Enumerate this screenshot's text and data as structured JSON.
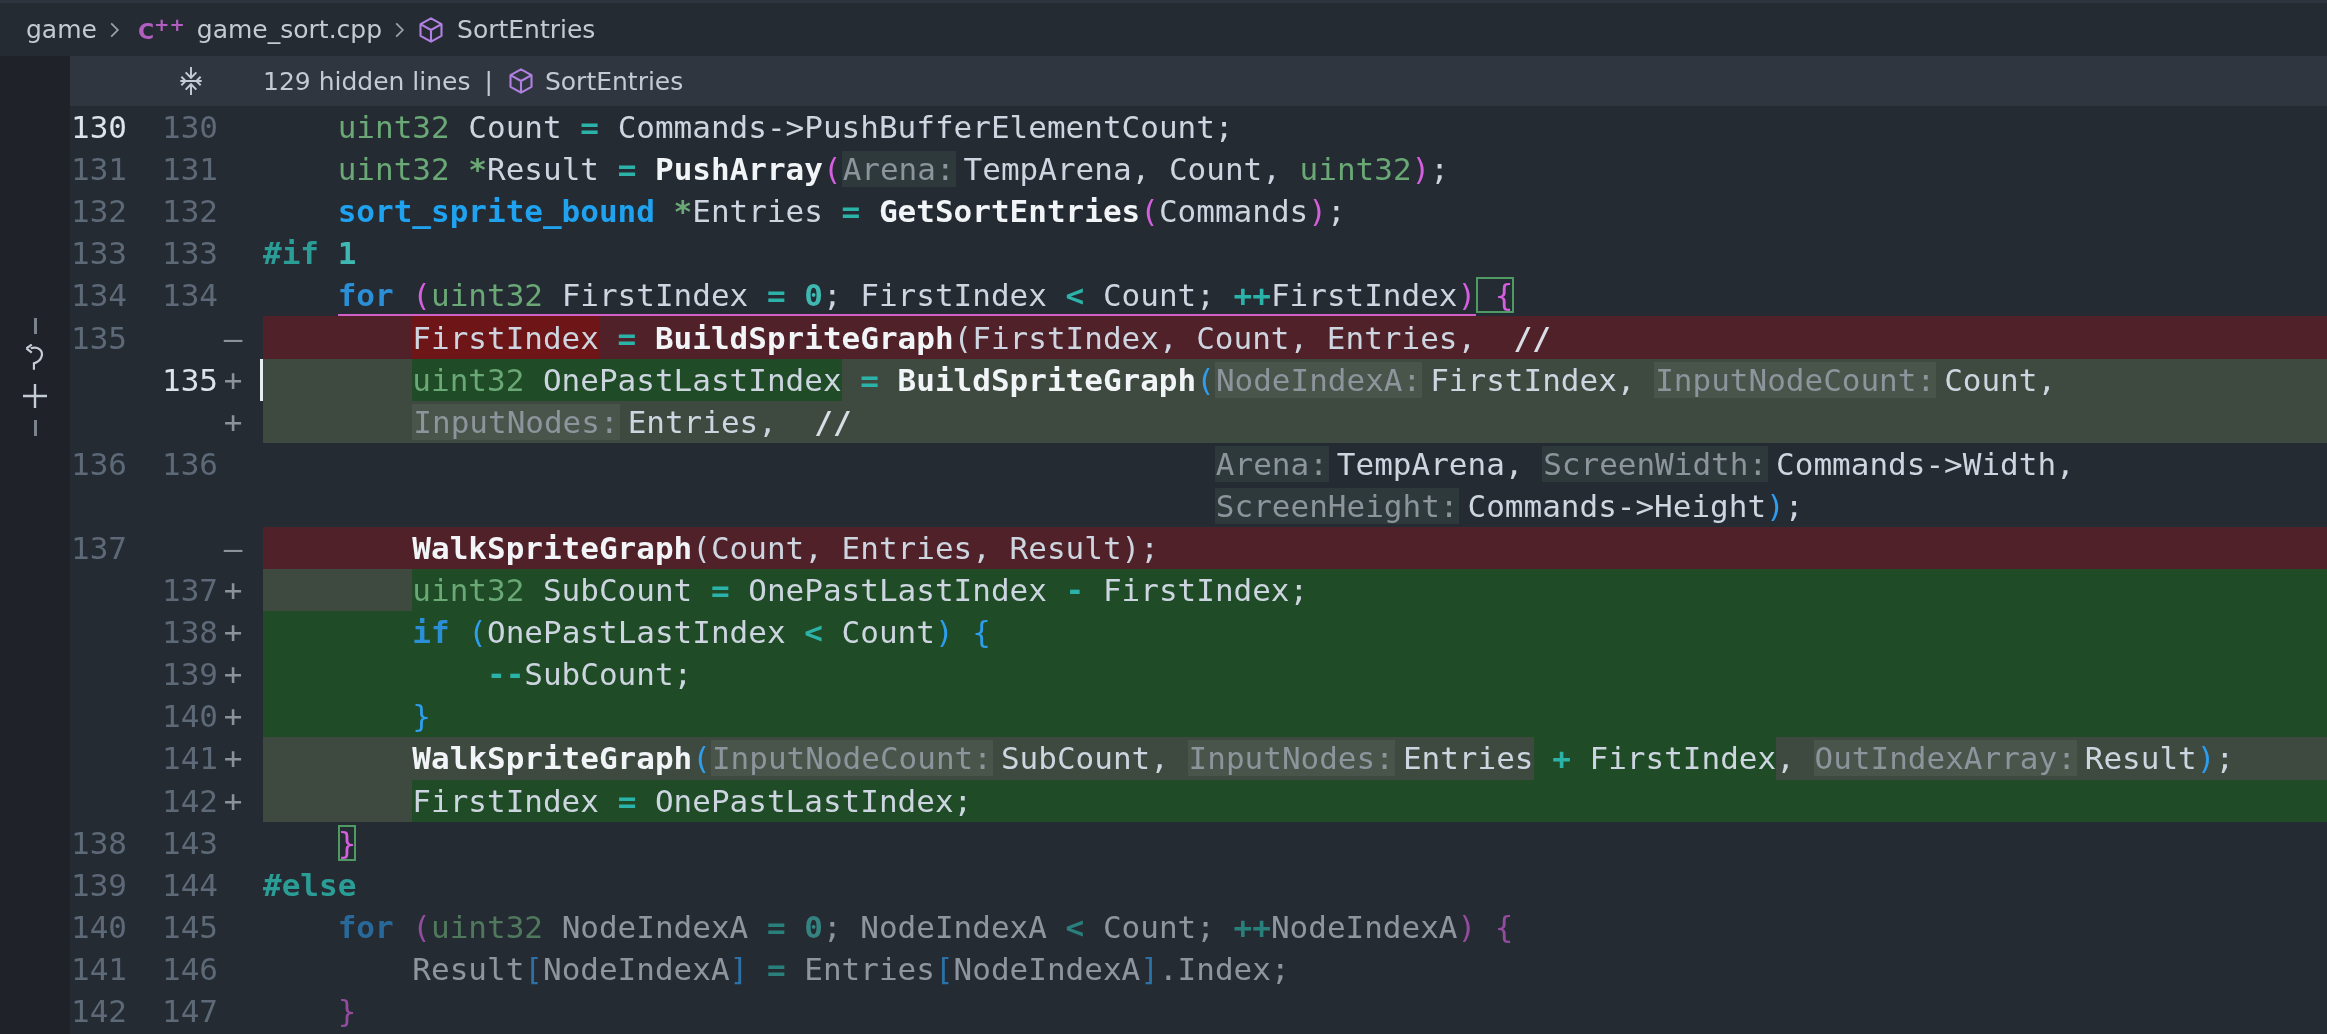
{
  "breadcrumb": [
    {
      "kind": "folder",
      "text": "game"
    },
    {
      "kind": "file",
      "icon": "C$^{++}$",
      "text": "game_sort.cpp"
    },
    {
      "kind": "symbol",
      "text": "SortEntries"
    }
  ],
  "fold_bar": {
    "text": "129 hidden lines",
    "separator": "|",
    "symbol": "SortEntries"
  },
  "lines": [
    {
      "orig": "130",
      "mod": "130",
      "kind": "context",
      "orig_current": true,
      "mod_current": false,
      "inactive": false,
      "segments": [
        {
          "kind": "plain",
          "tokens": [
            {
              "kind": "type",
              "text": "    uint32"
            },
            {
              "kind": "plain",
              "text": " Count "
            },
            {
              "kind": "op",
              "text": "="
            },
            {
              "kind": "plain",
              "text": " Commands->PushBufferElementCount;"
            }
          ]
        }
      ]
    },
    {
      "orig": "131",
      "mod": "131",
      "kind": "context",
      "orig_current": false,
      "mod_current": false,
      "inactive": false,
      "segments": [
        {
          "kind": "plain",
          "tokens": [
            {
              "kind": "type",
              "text": "    uint32 "
            },
            {
              "kind": "star",
              "text": "*"
            },
            {
              "kind": "plain",
              "text": "Result "
            },
            {
              "kind": "op",
              "text": "="
            },
            {
              "kind": "func",
              "text": " PushArray"
            },
            {
              "kind": "paren",
              "text": "("
            },
            {
              "kind": "hint",
              "text": "Arena:"
            },
            {
              "kind": "plain",
              "text": "TempArena, Count, "
            },
            {
              "kind": "type",
              "text": "uint32"
            },
            {
              "kind": "paren",
              "text": ")"
            },
            {
              "kind": "plain",
              "text": ";"
            }
          ]
        }
      ]
    },
    {
      "orig": "132",
      "mod": "132",
      "kind": "context",
      "orig_current": false,
      "mod_current": false,
      "inactive": false,
      "segments": [
        {
          "kind": "plain",
          "tokens": [
            {
              "kind": "struct",
              "text": "    sort_sprite_bound "
            },
            {
              "kind": "star",
              "text": "*"
            },
            {
              "kind": "plain",
              "text": "Entries "
            },
            {
              "kind": "op",
              "text": "="
            },
            {
              "kind": "func",
              "text": " GetSortEntries"
            },
            {
              "kind": "paren",
              "text": "("
            },
            {
              "kind": "plain",
              "text": "Commands"
            },
            {
              "kind": "paren",
              "text": ")"
            },
            {
              "kind": "plain",
              "text": ";"
            }
          ]
        }
      ]
    },
    {
      "orig": "133",
      "mod": "133",
      "kind": "context",
      "orig_current": false,
      "mod_current": false,
      "inactive": false,
      "segments": [
        {
          "kind": "plain",
          "tokens": [
            {
              "kind": "macro",
              "text": "#if "
            },
            {
              "kind": "number",
              "text": "1"
            }
          ]
        }
      ]
    },
    {
      "orig": "134",
      "mod": "134",
      "kind": "context",
      "orig_current": false,
      "mod_current": false,
      "inactive": false,
      "segments": [
        {
          "kind": "underlined",
          "tokens": [
            {
              "kind": "keyword",
              "text": "    for "
            },
            {
              "kind": "paren",
              "text": "("
            },
            {
              "kind": "type",
              "text": "uint32"
            },
            {
              "kind": "plain",
              "text": " FirstIndex "
            },
            {
              "kind": "op",
              "text": "="
            },
            {
              "kind": "number",
              "text": " 0"
            },
            {
              "kind": "plain",
              "text": "; FirstIndex "
            },
            {
              "kind": "op",
              "text": "<"
            },
            {
              "kind": "plain",
              "text": " Count; "
            },
            {
              "kind": "op",
              "text": "++"
            },
            {
              "kind": "plain",
              "text": "FirstIndex"
            },
            {
              "kind": "paren",
              "text": ")"
            }
          ]
        },
        {
          "kind": "plain",
          "tokens": [
            {
              "kind": "match",
              "text": " {"
            }
          ]
        }
      ]
    },
    {
      "orig": "135",
      "marker": "—",
      "kind": "removed",
      "orig_current": false,
      "inactive": false,
      "segments": [
        {
          "kind": "changed",
          "tokens": [
            {
              "kind": "plain",
              "text": "        FirstIndex"
            }
          ]
        },
        {
          "kind": "plain",
          "tokens": [
            {
              "kind": "op",
              "text": " = "
            },
            {
              "kind": "func",
              "text": "BuildSpriteGraph"
            },
            {
              "kind": "plain",
              "text": "(FirstIndex, Count, Entries,  "
            },
            {
              "kind": "comment",
              "text": "//"
            }
          ]
        }
      ]
    },
    {
      "mod": "135",
      "marker": "+",
      "kind": "added",
      "mod_current": true,
      "inactive": false,
      "segments": [
        {
          "kind": "changed",
          "tokens": [
            {
              "kind": "type",
              "text": "        uint32"
            },
            {
              "kind": "plain",
              "text": " OnePastLastIndex"
            }
          ]
        },
        {
          "kind": "plain",
          "tokens": [
            {
              "kind": "op",
              "text": " = "
            },
            {
              "kind": "func",
              "text": "BuildSpriteGraph"
            },
            {
              "kind": "paren2",
              "text": "("
            },
            {
              "kind": "hint",
              "text": "NodeIndexA:"
            },
            {
              "kind": "plain",
              "text": "FirstIndex, "
            },
            {
              "kind": "hint",
              "text": "InputNodeCount:"
            },
            {
              "kind": "plain",
              "text": "Count,"
            }
          ]
        }
      ]
    },
    {
      "marker": "+",
      "kind": "added",
      "inactive": false,
      "segments": [
        {
          "kind": "plain",
          "tokens": [
            {
              "kind": "hint",
              "text": "        InputNodes:"
            },
            {
              "kind": "plain",
              "text": "Entries,  "
            },
            {
              "kind": "comment",
              "text": "//"
            }
          ]
        }
      ]
    },
    {
      "orig": "136",
      "mod": "136",
      "kind": "context",
      "orig_current": false,
      "mod_current": false,
      "inactive": false,
      "segments": [
        {
          "kind": "plain",
          "tokens": [
            {
              "kind": "hint",
              "text": "                                                   Arena:"
            },
            {
              "kind": "plain",
              "text": "TempArena, "
            },
            {
              "kind": "hint",
              "text": "ScreenWidth:"
            },
            {
              "kind": "plain",
              "text": "Commands->Width,"
            }
          ]
        }
      ]
    },
    {
      "kind": "context",
      "inactive": false,
      "segments": [
        {
          "kind": "plain",
          "tokens": [
            {
              "kind": "hint",
              "text": "                                                   ScreenHeight:"
            },
            {
              "kind": "plain",
              "text": "Commands->Height"
            },
            {
              "kind": "paren2",
              "text": ")"
            },
            {
              "kind": "plain",
              "text": ";"
            }
          ]
        }
      ]
    },
    {
      "orig": "137",
      "marker": "—",
      "kind": "removed",
      "orig_current": false,
      "inactive": false,
      "segments": [
        {
          "kind": "plain",
          "tokens": [
            {
              "kind": "func",
              "text": "        WalkSpriteGraph"
            },
            {
              "kind": "plain",
              "text": "(Count, Entries, Result);"
            }
          ]
        }
      ]
    },
    {
      "mod": "137",
      "marker": "+",
      "kind": "added",
      "mod_current": false,
      "inactive": false,
      "segments": [
        {
          "kind": "changed",
          "tokens": [
            {
              "kind": "type",
              "text": "        uint32"
            },
            {
              "kind": "plain",
              "text": " SubCount "
            },
            {
              "kind": "op",
              "text": "="
            },
            {
              "kind": "plain",
              "text": " OnePastLastIndex "
            },
            {
              "kind": "op",
              "text": "-"
            },
            {
              "kind": "plain",
              "text": " FirstIndex;"
            }
          ]
        }
      ]
    },
    {
      "mod": "138",
      "marker": "+",
      "kind": "added",
      "mod_current": false,
      "inactive": false,
      "segments": [
        {
          "kind": "changed-all",
          "tokens": [
            {
              "kind": "keyword",
              "text": "        if "
            },
            {
              "kind": "paren2",
              "text": "("
            },
            {
              "kind": "plain",
              "text": "OnePastLastIndex "
            },
            {
              "kind": "op",
              "text": "<"
            },
            {
              "kind": "plain",
              "text": " Count"
            },
            {
              "kind": "paren2",
              "text": ")"
            },
            {
              "kind": "paren2",
              "text": " {"
            }
          ]
        }
      ]
    },
    {
      "mod": "139",
      "marker": "+",
      "kind": "added",
      "mod_current": false,
      "inactive": false,
      "segments": [
        {
          "kind": "changed-all",
          "tokens": [
            {
              "kind": "op",
              "text": "            --"
            },
            {
              "kind": "plain",
              "text": "SubCount;"
            }
          ]
        }
      ]
    },
    {
      "mod": "140",
      "marker": "+",
      "kind": "added",
      "mod_current": false,
      "inactive": false,
      "segments": [
        {
          "kind": "changed-all",
          "tokens": [
            {
              "kind": "paren2",
              "text": "        }"
            }
          ]
        }
      ]
    },
    {
      "mod": "141",
      "marker": "+",
      "kind": "added",
      "mod_current": false,
      "inactive": false,
      "segments": [
        {
          "kind": "plain",
          "tokens": [
            {
              "kind": "func",
              "text": "        WalkSpriteGraph"
            },
            {
              "kind": "paren2",
              "text": "("
            },
            {
              "kind": "hint",
              "text": "InputNodeCount:"
            },
            {
              "kind": "plain",
              "text": "SubCount, "
            },
            {
              "kind": "hint",
              "text": "InputNodes:"
            },
            {
              "kind": "plain",
              "text": "Entries"
            }
          ]
        },
        {
          "kind": "changed",
          "tokens": [
            {
              "kind": "op",
              "text": " + "
            },
            {
              "kind": "plain",
              "text": "FirstIndex"
            }
          ]
        },
        {
          "kind": "plain",
          "tokens": [
            {
              "kind": "plain",
              "text": ", "
            },
            {
              "kind": "hint",
              "text": "OutIndexArray:"
            },
            {
              "kind": "plain",
              "text": "Result"
            },
            {
              "kind": "paren2",
              "text": ")"
            },
            {
              "kind": "plain",
              "text": ";"
            }
          ]
        }
      ]
    },
    {
      "mod": "142",
      "marker": "+",
      "kind": "added",
      "mod_current": false,
      "inactive": false,
      "segments": [
        {
          "kind": "changed",
          "tokens": [
            {
              "kind": "plain",
              "text": "        FirstIndex "
            },
            {
              "kind": "op",
              "text": "="
            },
            {
              "kind": "plain",
              "text": " OnePastLastIndex;"
            }
          ]
        }
      ]
    },
    {
      "orig": "138",
      "mod": "143",
      "kind": "context",
      "orig_current": false,
      "mod_current": false,
      "inactive": false,
      "segments": [
        {
          "kind": "plain",
          "tokens": [
            {
              "kind": "match",
              "text": "    }"
            }
          ]
        }
      ]
    },
    {
      "orig": "139",
      "mod": "144",
      "kind": "context",
      "orig_current": false,
      "mod_current": false,
      "inactive": false,
      "segments": [
        {
          "kind": "plain",
          "tokens": [
            {
              "kind": "macro",
              "text": "#else"
            }
          ]
        }
      ]
    },
    {
      "orig": "140",
      "mod": "145",
      "kind": "context",
      "orig_current": false,
      "mod_current": false,
      "inactive": true,
      "segments": [
        {
          "kind": "plain",
          "tokens": [
            {
              "kind": "keyword",
              "text": "    for "
            },
            {
              "kind": "paren",
              "text": "("
            },
            {
              "kind": "type",
              "text": "uint32"
            },
            {
              "kind": "plain",
              "text": " NodeIndexA "
            },
            {
              "kind": "op",
              "text": "="
            },
            {
              "kind": "number",
              "text": " 0"
            },
            {
              "kind": "plain",
              "text": "; NodeIndexA "
            },
            {
              "kind": "op",
              "text": "<"
            },
            {
              "kind": "plain",
              "text": " Count; "
            },
            {
              "kind": "op",
              "text": "++"
            },
            {
              "kind": "plain",
              "text": "NodeIndexA"
            },
            {
              "kind": "paren",
              "text": ")"
            },
            {
              "kind": "paren",
              "text": " {"
            }
          ]
        }
      ]
    },
    {
      "orig": "141",
      "mod": "146",
      "kind": "context",
      "orig_current": false,
      "mod_current": false,
      "inactive": true,
      "segments": [
        {
          "kind": "plain",
          "tokens": [
            {
              "kind": "plain",
              "text": "        Result"
            },
            {
              "kind": "paren2",
              "text": "["
            },
            {
              "kind": "plain",
              "text": "NodeIndexA"
            },
            {
              "kind": "paren2",
              "text": "]"
            },
            {
              "kind": "op",
              "text": " = "
            },
            {
              "kind": "plain",
              "text": "Entries"
            },
            {
              "kind": "paren2",
              "text": "["
            },
            {
              "kind": "plain",
              "text": "NodeIndexA"
            },
            {
              "kind": "paren2",
              "text": "]"
            },
            {
              "kind": "plain",
              "text": ".Index;"
            }
          ]
        }
      ]
    },
    {
      "orig": "142",
      "mod": "147",
      "kind": "context",
      "orig_current": false,
      "mod_current": false,
      "inactive": true,
      "segments": [
        {
          "kind": "plain",
          "tokens": [
            {
              "kind": "paren",
              "text": "    }"
            }
          ]
        }
      ]
    }
  ]
}
